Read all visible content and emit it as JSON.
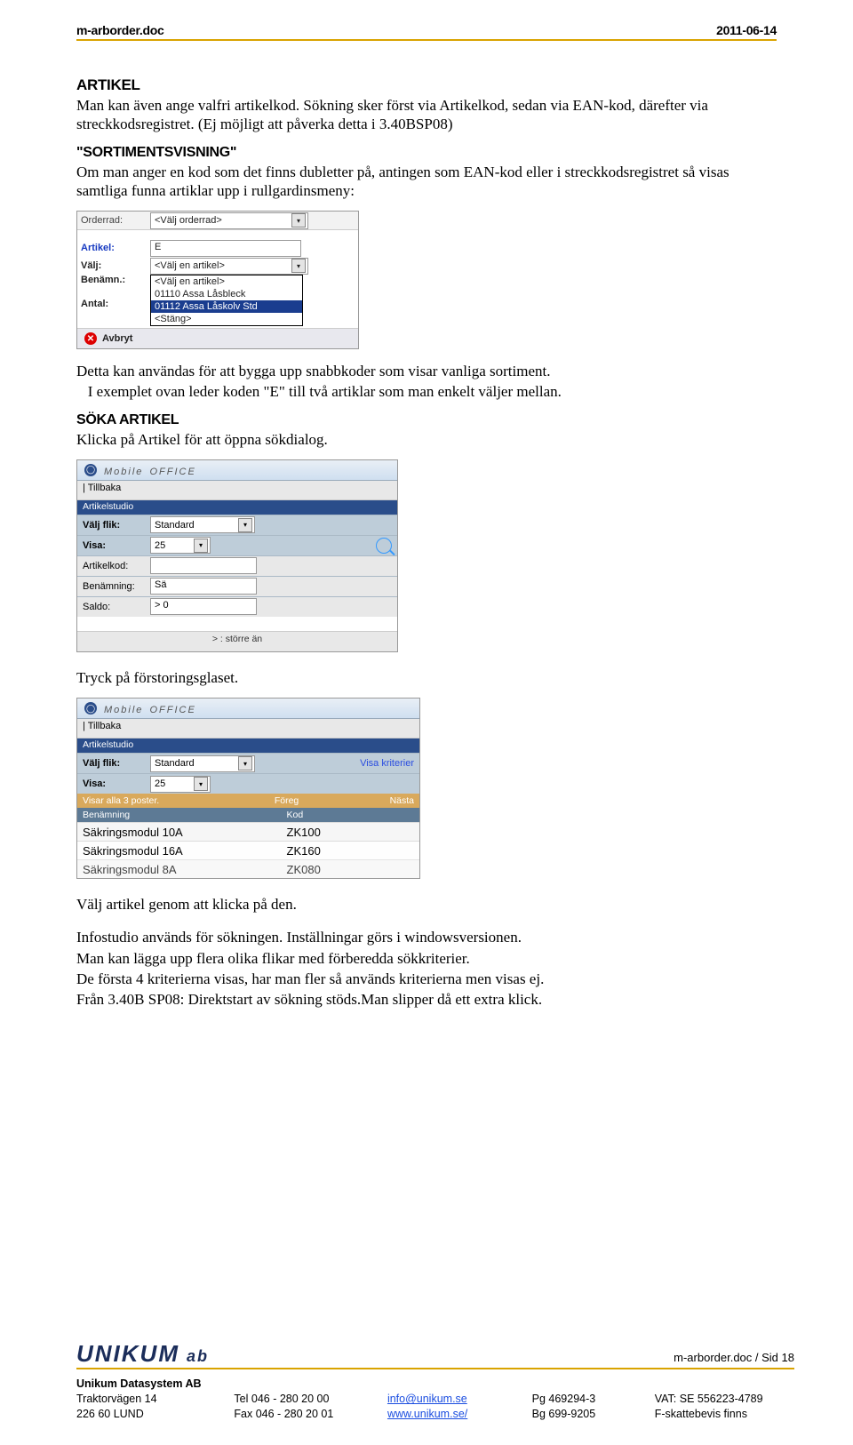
{
  "header": {
    "doc": "m-arborder.doc",
    "date": "2011-06-14"
  },
  "s1": {
    "title": "ARTIKEL",
    "p1": "Man kan även ange valfri artikelkod. Sökning sker först via Artikelkod, sedan via EAN-kod, därefter via streckkodsregistret. (Ej möjligt att påverka detta i 3.40BSP08)"
  },
  "s2": {
    "title": "\"SORTIMENTSVISNING\"",
    "p1": "Om man anger en kod som det finns dubletter på, antingen som EAN-kod eller i streckkodsregistret så visas samtliga funna artiklar upp i rullgardinsmeny:"
  },
  "ui1": {
    "orderrad": {
      "label": "Orderrad:",
      "value": "<Välj orderrad>"
    },
    "artikel": {
      "label": "Artikel:",
      "value": "E"
    },
    "valj": {
      "label": "Välj:",
      "value": "<Välj en artikel>"
    },
    "benamn": {
      "label": "Benämn.:"
    },
    "antal": {
      "label": "Antal:"
    },
    "options": [
      "<Välj en artikel>",
      "01110 Assa Låsbleck",
      "01112 Assa Låskolv Std",
      "<Stäng>"
    ],
    "avbryt": "Avbryt"
  },
  "s3": {
    "p1": "Detta kan användas för att bygga upp snabbkoder som visar vanliga sortiment.",
    "p2": "   I exemplet ovan leder koden \"E\" till två artiklar som man enkelt väljer mellan."
  },
  "s4": {
    "title": "SÖKA ARTIKEL",
    "p1": "Klicka på Artikel för att öppna sökdialog."
  },
  "ui2": {
    "logo_main": "Mobile",
    "logo_sub": " OFFICE",
    "crumb": "| Tillbaka",
    "section": "Artikelstudio",
    "flik_lab": "Välj flik:",
    "flik_val": "Standard",
    "visa_lab": "Visa:",
    "visa_val": "25",
    "akod_lab": "Artikelkod:",
    "akod_val": "",
    "benamn_lab": "Benämning:",
    "benamn_val": "Sä",
    "saldo_lab": "Saldo:",
    "saldo_val": "> 0",
    "foot": "> : större än"
  },
  "s5": {
    "p1": "Tryck på förstoringsglaset."
  },
  "ui3": {
    "logo_main": "Mobile",
    "logo_sub": " OFFICE",
    "crumb": "| Tillbaka",
    "section": "Artikelstudio",
    "flik_lab": "Välj flik:",
    "flik_val": "Standard",
    "visa_krit": "Visa kriterier",
    "visa_lab": "Visa:",
    "visa_val": "25",
    "pbar_left": "Visar alla 3 poster.",
    "pbar_mid": "Föreg",
    "pbar_right": "Nästa",
    "th_left": "Benämning",
    "th_right": "Kod",
    "rows": [
      {
        "name": "Säkringsmodul 10A",
        "code": "ZK100"
      },
      {
        "name": "Säkringsmodul 16A",
        "code": "ZK160"
      },
      {
        "name": "Säkringsmodul 8A",
        "code": "ZK080"
      }
    ]
  },
  "s6": {
    "p1": "Välj artikel genom att klicka på den.",
    "p2": "Infostudio används för sökningen. Inställningar görs i windowsversionen.",
    "p3": "Man kan lägga upp flera olika flikar med förberedda sökkriterier.",
    "p4": "De första 4 kriterierna visas, har man fler så används kriterierna men visas ej.",
    "p5": "Från 3.40B SP08:  Direktstart av sökning stöds.Man slipper då ett extra klick."
  },
  "footer": {
    "logo": "UNIKUM",
    "logo_ab": "ab",
    "page": "m-arborder.doc / Sid 18",
    "company": "Unikum Datasystem AB",
    "addr1": "Traktorvägen 14",
    "addr2": "226 60  LUND",
    "tel": "Tel  046 - 280 20 00",
    "fax": "Fax  046 - 280 20 01",
    "mail": "info@unikum.se",
    "web": "www.unikum.se/",
    "pg": "Pg  469294-3",
    "bg": "Bg  699-9205",
    "vat": "VAT: SE 556223-4789",
    "fsk": "F-skattebevis finns"
  }
}
